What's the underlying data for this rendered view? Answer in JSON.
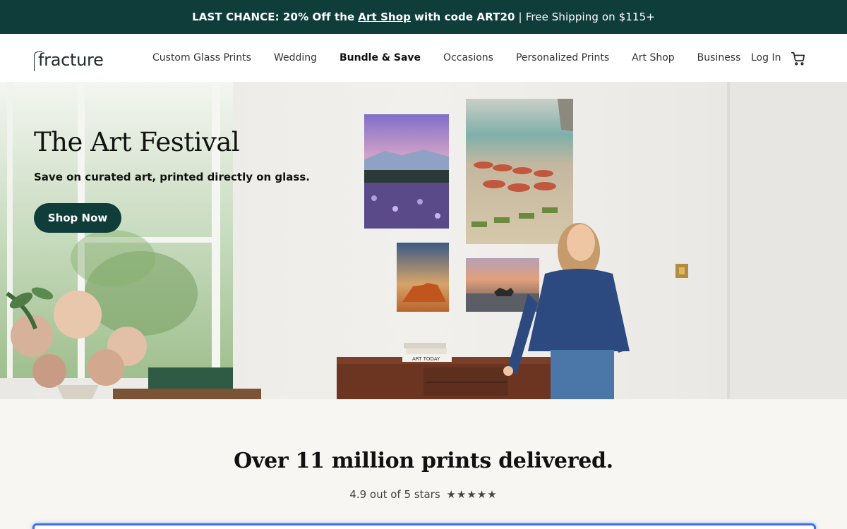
{
  "promo": {
    "lead": "LAST CHANCE: 20% Off the",
    "link": "Art Shop",
    "code_text": "with code ART20",
    "divider": "|",
    "shipping": "Free Shipping on $115+"
  },
  "header": {
    "logo": "fracture",
    "nav": [
      {
        "label": "Custom Glass Prints"
      },
      {
        "label": "Wedding"
      },
      {
        "label": "Bundle & Save"
      },
      {
        "label": "Occasions"
      },
      {
        "label": "Personalized Prints"
      },
      {
        "label": "Art Shop"
      },
      {
        "label": "Business"
      }
    ],
    "login": "Log In"
  },
  "hero": {
    "title": "The Art Festival",
    "subtitle": "Save on curated art, printed directly on glass.",
    "cta": "Shop Now",
    "book_label": "ART TODAY"
  },
  "stats": {
    "title": "Over 11 million prints delivered.",
    "rating_text": "4.9 out of 5 stars",
    "stars": "★★★★★"
  },
  "colors": {
    "brand": "#0f3d3a",
    "focus": "#3b6ff0"
  }
}
